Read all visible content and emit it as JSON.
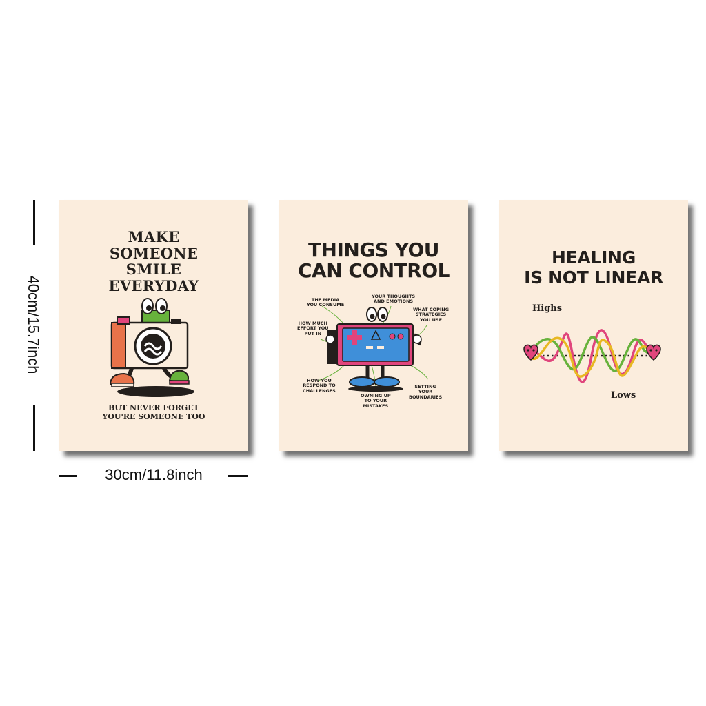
{
  "posters": [
    {
      "title_lines": [
        "MAKE",
        "SOMEONE",
        "SMILE",
        "EVERYDAY"
      ],
      "subtitle_lines": [
        "BUT NEVER FORGET",
        "YOU'RE SOMEONE TOO"
      ],
      "illustration": "walking-camera-character-icon"
    },
    {
      "title_lines": [
        "THINGS YOU",
        "CAN CONTROL"
      ],
      "illustration": "game-controller-character-icon",
      "labels": [
        {
          "lines": [
            "THE MEDIA",
            "YOU CONSUME"
          ]
        },
        {
          "lines": [
            "YOUR THOUGHTS",
            "AND EMOTIONS"
          ]
        },
        {
          "lines": [
            "WHAT COPING",
            "STRATEGIES",
            "YOU USE"
          ]
        },
        {
          "lines": [
            "HOW MUCH",
            "EFFORT YOU",
            "PUT IN"
          ]
        },
        {
          "lines": [
            "HOW YOU",
            "RESPOND TO",
            "CHALLENGES"
          ]
        },
        {
          "lines": [
            "OWNING UP",
            "TO YOUR",
            "MISTAKES"
          ]
        },
        {
          "lines": [
            "SETTING",
            "YOUR",
            "BOUNDARIES"
          ]
        }
      ]
    },
    {
      "title_lines": [
        "HEALING",
        "IS NOT LINEAR"
      ],
      "highs_label": "Highs",
      "lows_label": "Lows",
      "illustration": "wavy-lines-heart-icon"
    }
  ],
  "dimensions": {
    "height": "40cm/15.7inch",
    "width": "30cm/11.8inch"
  },
  "colors": {
    "poster_bg": "#fbeddd",
    "ink": "#231f1c",
    "pink": "#e0457c",
    "green": "#67b23c",
    "yellow": "#e8b822",
    "blue": "#3f8fd9",
    "orange": "#e8734a"
  }
}
